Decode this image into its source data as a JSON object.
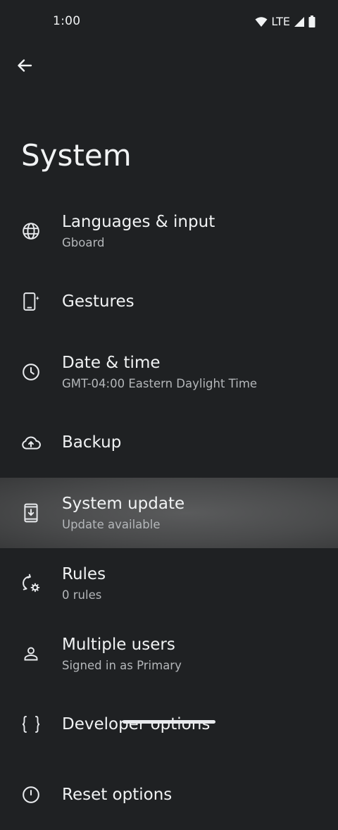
{
  "status": {
    "time": "1:00",
    "network": "LTE"
  },
  "page": {
    "title": "System"
  },
  "items": [
    {
      "title": "Languages & input",
      "subtitle": "Gboard",
      "icon": "globe-icon"
    },
    {
      "title": "Gestures",
      "subtitle": "",
      "icon": "phone-gesture-icon"
    },
    {
      "title": "Date & time",
      "subtitle": "GMT-04:00 Eastern Daylight Time",
      "icon": "clock-icon"
    },
    {
      "title": "Backup",
      "subtitle": "",
      "icon": "cloud-upload-icon"
    },
    {
      "title": "System update",
      "subtitle": "Update available",
      "icon": "system-update-icon"
    },
    {
      "title": "Rules",
      "subtitle": "0 rules",
      "icon": "rules-icon"
    },
    {
      "title": "Multiple users",
      "subtitle": "Signed in as Primary",
      "icon": "person-icon"
    },
    {
      "title": "Developer options",
      "subtitle": "",
      "icon": "braces-icon"
    },
    {
      "title": "Reset options",
      "subtitle": "",
      "icon": "reset-clock-icon"
    }
  ],
  "colors": {
    "background": "#1f2123",
    "highlight": "#4a4b4c",
    "text_primary": "#f1f3f4",
    "text_secondary": "#b4b7ba"
  }
}
